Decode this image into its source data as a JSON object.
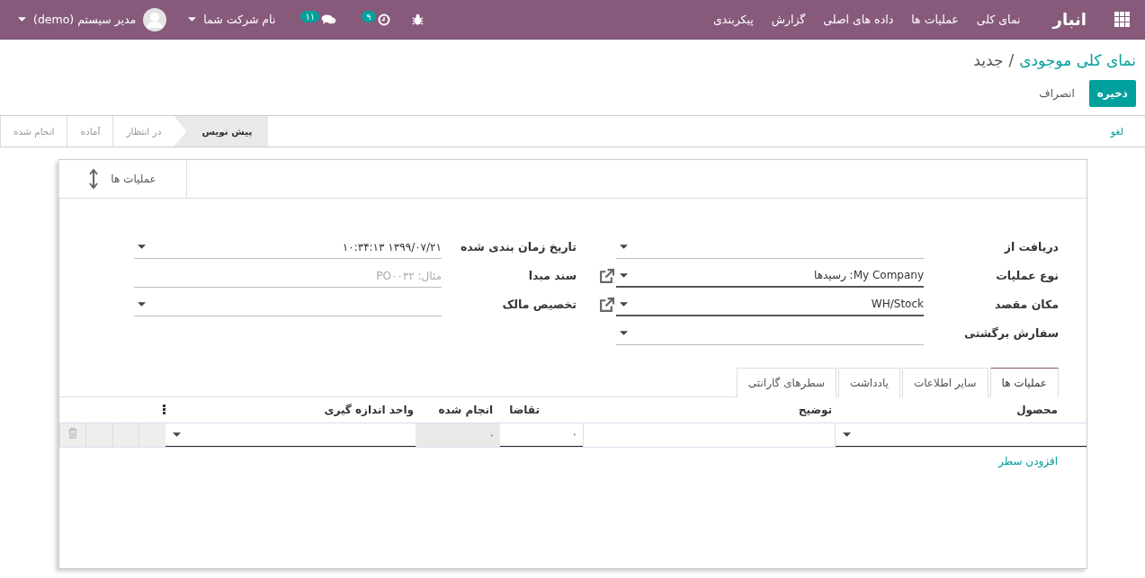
{
  "navbar": {
    "app_title": "انبار",
    "menus": [
      "نمای کلی",
      "عملیات ها",
      "داده های اصلی",
      "گزارش",
      "پیکربندی"
    ],
    "activity_count": "۹",
    "message_count": "۱۱",
    "company": "نام شرکت شما",
    "user": "مدیر سیستم (demo)"
  },
  "breadcrumb": {
    "parent": "نمای کلی موجودی",
    "separator": "/",
    "current": "جدید"
  },
  "buttons": {
    "save": "ذخیره",
    "discard": "انصراف"
  },
  "status_bar": {
    "action": "لغو",
    "stages": [
      {
        "label": "پیش نویس",
        "selected": true
      },
      {
        "label": "در انتظار",
        "selected": false
      },
      {
        "label": "آماده",
        "selected": false
      },
      {
        "label": "انجام شده",
        "selected": false
      }
    ]
  },
  "smart_button": {
    "label": "عملیات ها"
  },
  "groups": [
    [
      {
        "label": "دریافت از",
        "kind": "many2one",
        "required": false,
        "link": false
      },
      {
        "label": "نوع عملیات",
        "kind": "many2one",
        "value": "My Company: رسیدها",
        "required": true,
        "link": true
      },
      {
        "label": "مکان مقصد",
        "kind": "many2one",
        "value": "WH/Stock",
        "required": true,
        "link": true
      },
      {
        "label": "سفارش برگشتی",
        "kind": "many2one",
        "required": false,
        "link": false
      }
    ],
    [
      {
        "label": "تاریخ زمان بندی شده",
        "kind": "many2one",
        "value": "۱۳۹۹/۰۷/۲۱ ۱۰:۳۴:۱۳",
        "required": false,
        "link": false
      },
      {
        "label": "سند مبدا",
        "kind": "char",
        "placeholder": "مثال: PO۰۰۳۲",
        "required": false,
        "link": false
      },
      {
        "label": "تخصیص مالک",
        "kind": "many2one",
        "required": false,
        "link": false
      }
    ]
  ],
  "tabs": [
    {
      "label": "عملیات ها",
      "selected": true
    },
    {
      "label": "سایر اطلاعات",
      "selected": false
    },
    {
      "label": "یادداشت",
      "selected": false
    },
    {
      "label": "سطرهای گارانتی",
      "selected": false
    }
  ],
  "table": {
    "columns": [
      "محصول",
      "توضیح",
      "تقاضا",
      "انجام شده",
      "واحد اندازه گیری"
    ],
    "row": [
      {
        "kind": "many2one"
      },
      {
        "kind": "text"
      },
      {
        "kind": "number",
        "value": "۰"
      },
      {
        "kind": "readonly",
        "value": "۰"
      },
      {
        "kind": "many2one"
      }
    ],
    "add_line": "افزودن سطر"
  }
}
